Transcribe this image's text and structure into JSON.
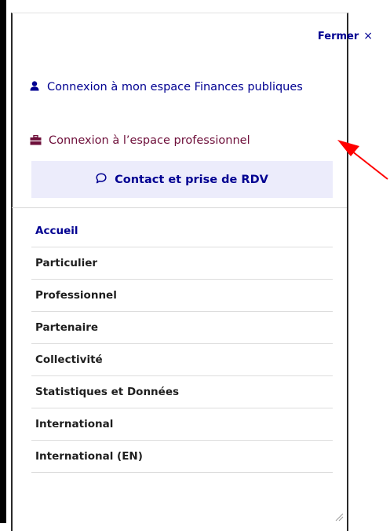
{
  "menu": {
    "close_label": "Fermer",
    "close_glyph": "×",
    "finances_link_label": "Connexion à mon espace Finances publiques",
    "finances_icon": "user-icon",
    "pro_link_label": "Connexion à l’espace professionnel",
    "pro_icon": "briefcase-icon",
    "contact_label": "Contact et prise de RDV",
    "contact_icon": "chat-bubble-icon",
    "nav_items": [
      {
        "label": "Accueil",
        "active": true
      },
      {
        "label": "Particulier",
        "active": false
      },
      {
        "label": "Professionnel",
        "active": false
      },
      {
        "label": "Partenaire",
        "active": false
      },
      {
        "label": "Collectivité",
        "active": false
      },
      {
        "label": "Statistiques et Données",
        "active": false
      },
      {
        "label": "International",
        "active": false
      },
      {
        "label": "International (EN)",
        "active": false
      }
    ]
  },
  "colors": {
    "primary_blue": "#000091",
    "pro_burgundy": "#6e0f3a",
    "contact_bg": "#ececfb",
    "annotation_arrow": "#ff0000"
  }
}
